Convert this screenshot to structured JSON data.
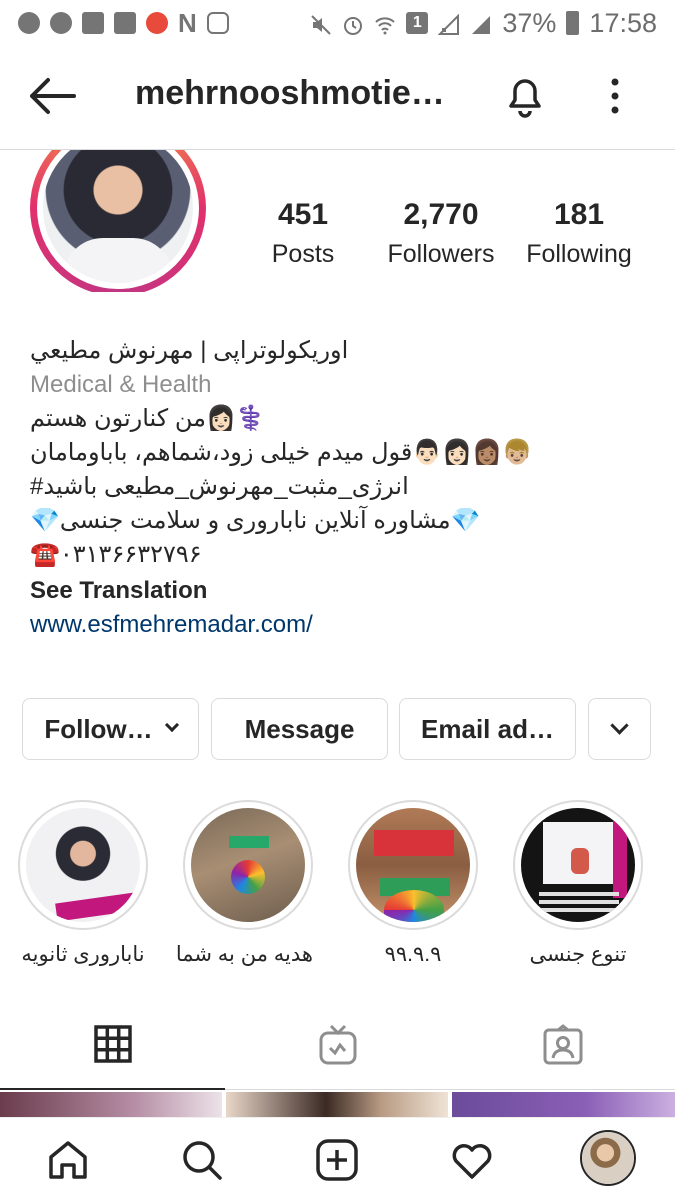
{
  "status_bar": {
    "battery": "37%",
    "time": "17:58",
    "n_glyph": "N",
    "sim_label": "1"
  },
  "header": {
    "username": "mehrnooshmotie…"
  },
  "profile": {
    "stats": [
      {
        "value": "451",
        "label": "Posts"
      },
      {
        "value": "2,770",
        "label": "Followers"
      },
      {
        "value": "181",
        "label": "Following"
      }
    ],
    "bio": {
      "name_line": "اوریکولوتراپی | مهرنوش مطیعي",
      "category": "Medical & Health",
      "line1": "⚕️👩🏻من کنارتون هستم",
      "line2": "👦🏼👩🏽👩🏻👨🏻قول میدم خیلی زود،شماهم، باباومامان",
      "line3": "انرژی_مثبت_مهرنوش_مطیعی باشید#",
      "line4": "💎مشاوره آنلاین ناباروری و سلامت جنسی💎",
      "line5": "☎️۰۳۱۳۶۶۳۲۷۹۶",
      "see_translation": "See Translation",
      "website": "www.esfmehremadar.com/"
    }
  },
  "actions": {
    "following": "Follow…",
    "message": "Message",
    "email": "Email ad…"
  },
  "highlights": [
    {
      "label": "ناباروری ثانویه"
    },
    {
      "label": "هدیه من به شما"
    },
    {
      "label": "۹۹.۹.۹"
    },
    {
      "label": "تنوع جنسی"
    }
  ]
}
